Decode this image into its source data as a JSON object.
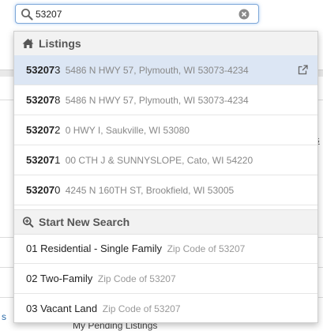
{
  "search": {
    "value": "53207"
  },
  "background": {
    "right_fragments": [
      "y",
      "as",
      "(",
      "("
    ],
    "bottom_left": "s",
    "bottom_text": "My Pending Listings"
  },
  "listings_section": {
    "title": "Listings",
    "items": [
      {
        "mls_match": "53207",
        "mls_rest": "3",
        "address": "5486 N HWY 57, Plymouth, WI 53073-4234",
        "active": true
      },
      {
        "mls_match": "53207",
        "mls_rest": "8",
        "address": "5486 N HWY 57, Plymouth, WI 53073-4234",
        "active": false
      },
      {
        "mls_match": "53207",
        "mls_rest": "2",
        "address": "0 HWY I, Saukville, WI 53080",
        "active": false
      },
      {
        "mls_match": "53207",
        "mls_rest": "1",
        "address": "00 CTH J & SUNNYSLOPE, Cato, WI 54220",
        "active": false
      },
      {
        "mls_match": "53207",
        "mls_rest": "0",
        "address": "4245 N 160TH ST, Brookfield, WI 53005",
        "active": false
      }
    ]
  },
  "new_search_section": {
    "title": "Start New Search",
    "items": [
      {
        "label": "01 Residential - Single Family",
        "sub": "Zip Code of 53207"
      },
      {
        "label": "02 Two-Family",
        "sub": "Zip Code of 53207"
      },
      {
        "label": "03 Vacant Land",
        "sub": "Zip Code of 53207"
      }
    ]
  },
  "colors": {
    "accent_border": "#7ea7d8",
    "active_row": "#dce6f4",
    "header_bg": "#f2f2f2"
  }
}
